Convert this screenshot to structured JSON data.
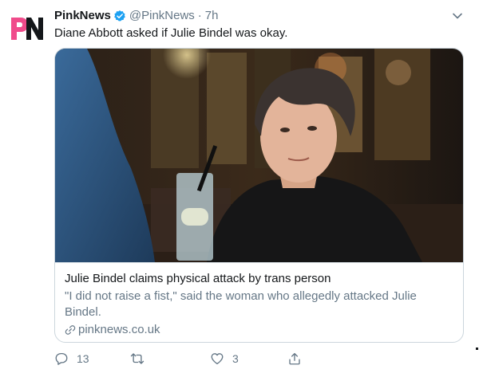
{
  "tweet": {
    "author_name": "PinkNews",
    "author_handle": "@PinkNews",
    "separator": "·",
    "time": "7h",
    "text": "Diane Abbott asked if Julie Bindel was okay."
  },
  "card": {
    "title": "Julie Bindel claims physical attack by trans person",
    "description": "\"I did not raise a fist,\" said the woman who allegedly attacked Julie Bindel.",
    "domain": "pinknews.co.uk"
  },
  "actions": {
    "reply_count": "13",
    "retweet_count": "",
    "like_count": "3"
  },
  "icons": {
    "logo": "pinknews-logo",
    "verified": "verified-badge-icon",
    "menu": "chevron-down-icon",
    "reply": "reply-icon",
    "retweet": "retweet-icon",
    "like": "heart-icon",
    "share": "share-icon",
    "link": "link-icon"
  },
  "colors": {
    "logo_pink": "#f04b8b",
    "verified_blue": "#1da1f2",
    "secondary_text": "#657786",
    "border": "#ccd6dd"
  }
}
